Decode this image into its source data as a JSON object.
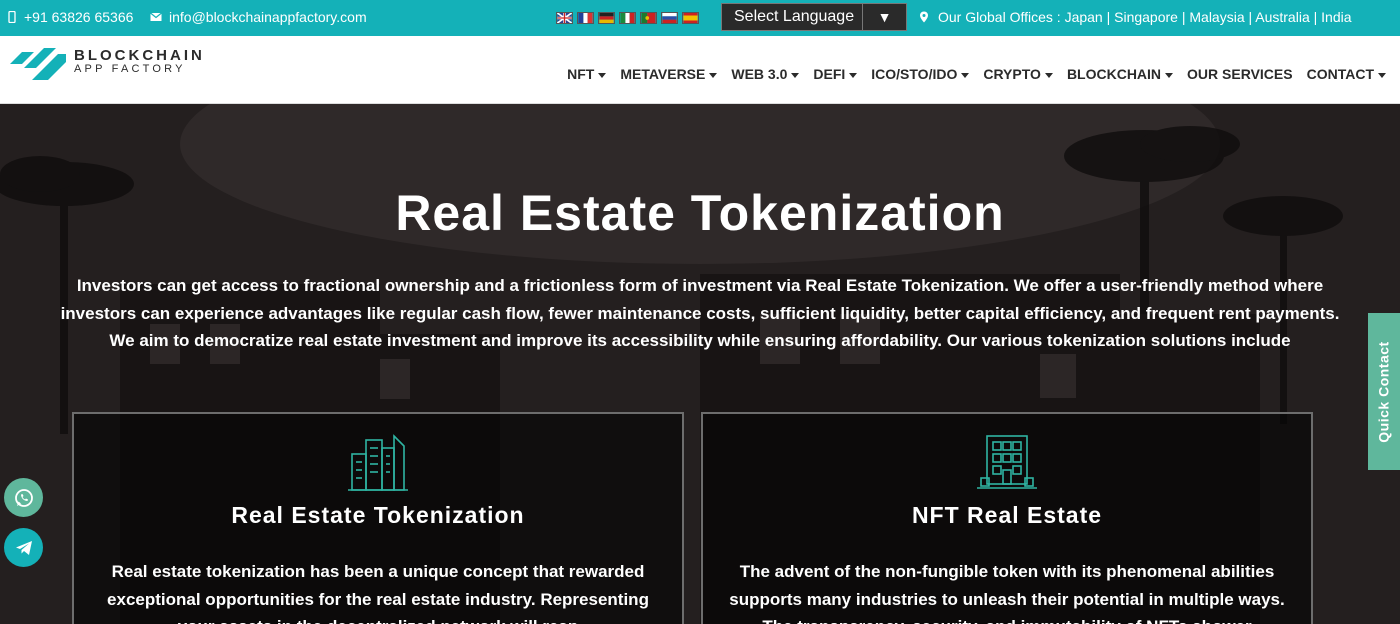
{
  "topbar": {
    "phone": "+91 63826 65366",
    "email": "info@blockchainappfactory.com",
    "language_select": "Select Language",
    "offices": "Our Global Offices : Japan | Singapore | Malaysia | Australia | India",
    "flag_icons": [
      "uk-flag-icon",
      "france-flag-icon",
      "germany-flag-icon",
      "italy-flag-icon",
      "portugal-flag-icon",
      "russia-flag-icon",
      "spain-flag-icon"
    ]
  },
  "logo": {
    "line1": "BLOCKCHAIN",
    "line2": "APP FACTORY"
  },
  "nav": [
    {
      "label": "NFT",
      "dropdown": true
    },
    {
      "label": "METAVERSE",
      "dropdown": true
    },
    {
      "label": "WEB 3.0",
      "dropdown": true
    },
    {
      "label": "DEFI",
      "dropdown": true
    },
    {
      "label": "ICO/STO/IDO",
      "dropdown": true
    },
    {
      "label": "CRYPTO",
      "dropdown": true
    },
    {
      "label": "BLOCKCHAIN",
      "dropdown": true
    },
    {
      "label": "OUR SERVICES",
      "dropdown": false
    },
    {
      "label": "CONTACT",
      "dropdown": true
    }
  ],
  "hero": {
    "title": "Real Estate Tokenization",
    "description": "Investors can get access to fractional ownership and a frictionless form of investment via Real Estate Tokenization. We offer a user-friendly method where investors can experience advantages like regular cash flow, fewer maintenance costs, sufficient liquidity, better capital efficiency, and frequent rent payments. We aim to democratize real estate investment and improve its accessibility while ensuring affordability. Our various tokenization solutions include"
  },
  "cards": [
    {
      "icon": "buildings-icon",
      "title": "Real Estate Tokenization",
      "text": "Real estate tokenization has been a unique concept that rewarded exceptional opportunities for the real estate industry. Representing your assets in the decentralized network will reap"
    },
    {
      "icon": "apartment-building-icon",
      "title": "NFT Real Estate",
      "text": "The advent of the non-fungible token with its phenomenal abilities supports many industries to unleash their potential in multiple ways. The transparency, security, and immutability of NFTs shower"
    }
  ],
  "quick_contact": "Quick Contact",
  "colors": {
    "topbar": "#14b1b8",
    "accent_green": "#5fb79c",
    "icon_teal": "#2fb4a2"
  }
}
